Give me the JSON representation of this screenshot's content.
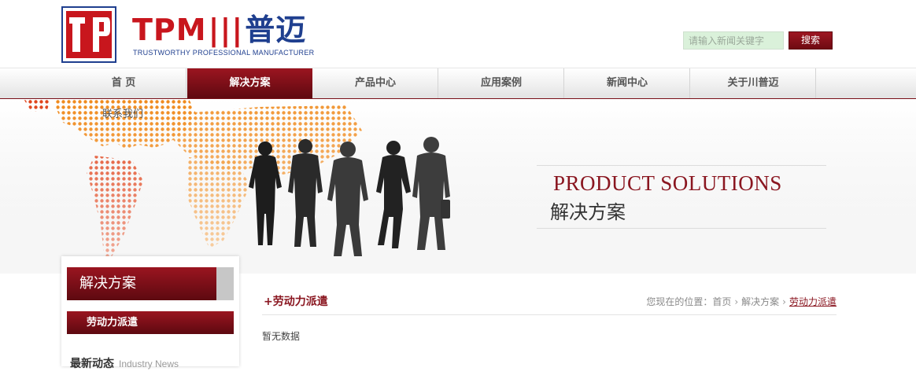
{
  "header": {
    "logo_icon": "tpm-logo-icon",
    "brand_tpm": "TPM",
    "brand_cn": "普迈",
    "brand_tagline": "TRUSTWORTHY PROFESSIONAL MANUFACTURER",
    "search_placeholder": "请输入新闻关键字",
    "search_button": "搜索"
  },
  "nav": {
    "items": [
      {
        "label": "首 页"
      },
      {
        "label": "解决方案",
        "active": true
      },
      {
        "label": "产品中心"
      },
      {
        "label": "应用案例"
      },
      {
        "label": "新闻中心"
      },
      {
        "label": "关于川普迈"
      }
    ],
    "dropdown_item": "联系我们"
  },
  "banner": {
    "title_en": "PRODUCT SOLUTIONS",
    "title_cn": "解决方案"
  },
  "sidebar": {
    "title": "解决方案",
    "items": [
      {
        "label": "劳动力派遣"
      }
    ],
    "news_title_cn": "最新动态",
    "news_title_en": "Industry News"
  },
  "main": {
    "title": "+劳动力派遣",
    "breadcrumb": {
      "prefix": "您现在的位置：",
      "items": [
        "首页",
        "解决方案",
        "劳动力派遣"
      ]
    },
    "empty_text": "暂无数据"
  },
  "colors": {
    "brand_red": "#c8161d",
    "brand_blue": "#1f3f8f",
    "accent_dark_red": "#8a1620",
    "search_bg": "#daf1da"
  }
}
